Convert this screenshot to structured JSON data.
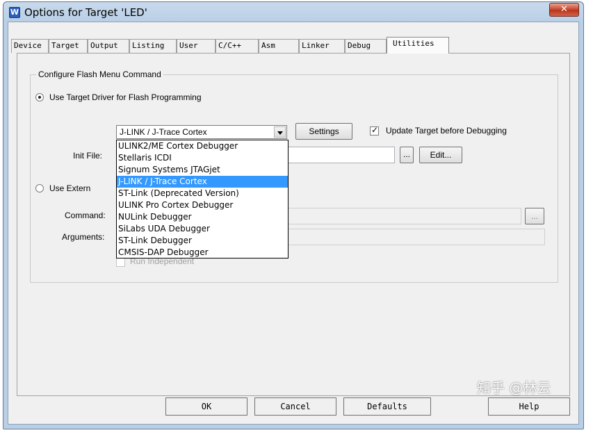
{
  "window": {
    "title": "Options for Target 'LED'"
  },
  "tabs": [
    {
      "label": "Device"
    },
    {
      "label": "Target"
    },
    {
      "label": "Output"
    },
    {
      "label": "Listing"
    },
    {
      "label": "User"
    },
    {
      "label": "C/C++"
    },
    {
      "label": "Asm"
    },
    {
      "label": "Linker"
    },
    {
      "label": "Debug"
    },
    {
      "label": "Utilities"
    }
  ],
  "active_tab": "Utilities",
  "flash_group": {
    "legend": "Configure Flash Menu Command",
    "use_target_driver_label": "Use Target Driver for Flash Programming",
    "driver_combo_value": "J-LINK / J-Trace Cortex",
    "settings_label": "Settings",
    "update_target_label": "Update Target before Debugging",
    "init_file_label": "Init File:",
    "init_browse_label": "...",
    "edit_label": "Edit...",
    "use_external_label": "Use Extern",
    "command_label": "Command:",
    "command_browse_label": "...",
    "arguments_label": "Arguments:",
    "run_independent_label": "Run Independent"
  },
  "dropdown": {
    "options": [
      "ULINK2/ME Cortex Debugger",
      "Stellaris ICDI",
      "Signum Systems JTAGjet",
      "J-LINK / J-Trace Cortex",
      "ST-Link (Deprecated Version)",
      "ULINK Pro Cortex Debugger",
      "NULink Debugger",
      "SiLabs UDA Debugger",
      "ST-Link Debugger",
      "CMSIS-DAP Debugger"
    ],
    "selected": "J-LINK / J-Trace Cortex"
  },
  "footer": {
    "ok_label": "OK",
    "cancel_label": "Cancel",
    "defaults_label": "Defaults",
    "help_label": "Help"
  },
  "watermark": "知乎 @林云"
}
